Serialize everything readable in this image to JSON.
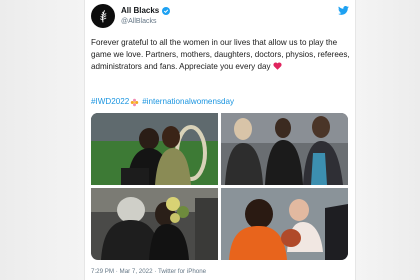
{
  "tweet": {
    "display_name": "All Blacks",
    "handle": "@AllBlacks",
    "text": "Forever grateful to all the women in our lives that allow us to play the game we love. Partners, mothers, daughters, doctors, physios, referees, administrators and fans. Appreciate you every day",
    "hashtag_1": "#IWD2022",
    "hashtag_2": "#internationalwomensday",
    "timestamp": "7:29 PM · Mar 7, 2022 · Twitter for iPhone",
    "photos": [
      "photo-stadium-couple",
      "photo-family-group",
      "photo-embrace-flowers",
      "photo-holding-baby"
    ]
  },
  "icons": {
    "avatar": "silver-fern-logo",
    "verified": "verified-badge-icon",
    "bird": "twitter-bird-icon",
    "heart": "red-heart-emoji",
    "flower": "flower-emoji"
  },
  "colors": {
    "link": "#1b95e0",
    "heart": "#e0245e",
    "verified": "#1da1f2",
    "avatar_bg": "#0d0d0d"
  }
}
